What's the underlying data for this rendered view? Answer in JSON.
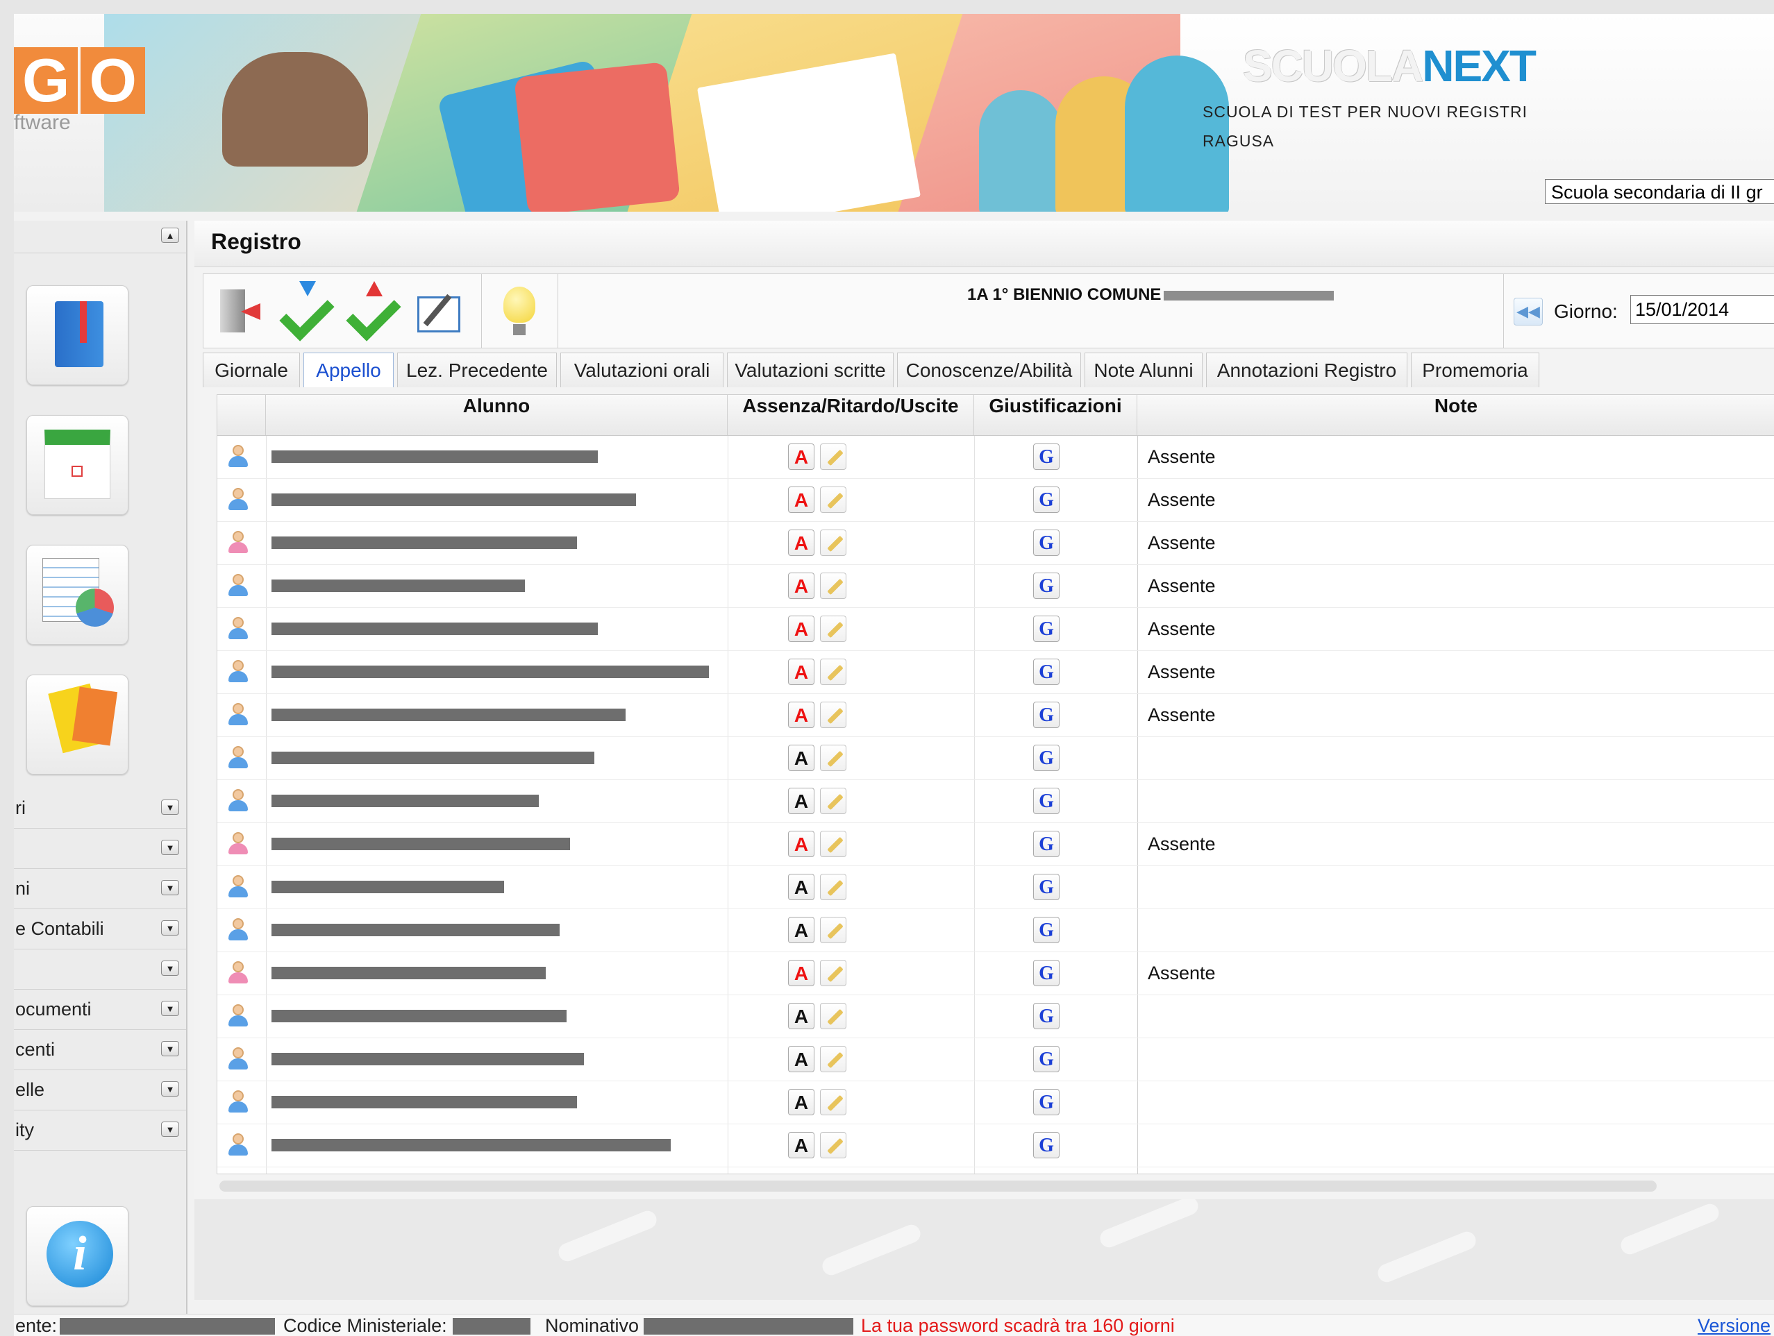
{
  "banner": {
    "logo_letters": [
      "G",
      "O"
    ],
    "logo_sub": "ftware",
    "brand_left": "SCUOLA",
    "brand_right": "NEXT",
    "school_name": "SCUOLA DI TEST PER NUOVI REGISTRI",
    "school_city": "RAGUSA",
    "school_select_value": "Scuola secondaria di II gr"
  },
  "sidebar": {
    "collapse_symbol": "▲",
    "expand_symbol": "▼",
    "launchers": [
      "book-icon",
      "calendar-icon",
      "chart-icon",
      "cards-icon"
    ],
    "info_symbol": "i",
    "menu": [
      {
        "label": "ri"
      },
      {
        "label": ""
      },
      {
        "label": "ni"
      },
      {
        "label": "e Contabili"
      },
      {
        "label": ""
      },
      {
        "label": "ocumenti"
      },
      {
        "label": "centi"
      },
      {
        "label": "elle"
      },
      {
        "label": "ity"
      }
    ]
  },
  "main": {
    "title": "Registro",
    "class_label": "1A 1° BIENNIO COMUNE",
    "toolbar_icons": [
      "exit-icon",
      "check-down-icon",
      "check-up-icon",
      "edit-icon",
      "bulb-icon"
    ],
    "date_nav_symbol": "◀◀",
    "date_label": "Giorno:",
    "date_value": "15/01/2014",
    "tabs": [
      "Giornale",
      "Appello",
      "Lez. Precedente",
      "Valutazioni orali",
      "Valutazioni scritte",
      "Conoscenze/Abilità",
      "Note Alunni",
      "Annotazioni Registro",
      "Promemoria"
    ],
    "active_tab": "Appello",
    "columns": [
      "Alunno",
      "Assenza/Ritardo/Uscite",
      "Giustificazioni",
      "Note"
    ],
    "absent_button_label": "A",
    "justify_button_label": "G",
    "rows": [
      {
        "student": "",
        "gender": "male",
        "absent": true,
        "note": "Assente"
      },
      {
        "student": "",
        "gender": "male",
        "absent": true,
        "note": "Assente"
      },
      {
        "student": "",
        "gender": "female",
        "absent": true,
        "note": "Assente"
      },
      {
        "student": "",
        "gender": "male",
        "absent": true,
        "note": "Assente"
      },
      {
        "student": "",
        "gender": "male",
        "absent": true,
        "note": "Assente"
      },
      {
        "student": "",
        "gender": "male",
        "absent": true,
        "note": "Assente"
      },
      {
        "student": "",
        "gender": "male",
        "absent": true,
        "note": "Assente"
      },
      {
        "student": "",
        "gender": "male",
        "absent": false,
        "note": ""
      },
      {
        "student": "",
        "gender": "male",
        "absent": false,
        "note": ""
      },
      {
        "student": "",
        "gender": "female",
        "absent": true,
        "note": "Assente"
      },
      {
        "student": "",
        "gender": "male",
        "absent": false,
        "note": ""
      },
      {
        "student": "",
        "gender": "male",
        "absent": false,
        "note": ""
      },
      {
        "student": "",
        "gender": "female",
        "absent": true,
        "note": "Assente"
      },
      {
        "student": "",
        "gender": "male",
        "absent": false,
        "note": ""
      },
      {
        "student": "",
        "gender": "male",
        "absent": false,
        "note": ""
      },
      {
        "student": "",
        "gender": "male",
        "absent": false,
        "note": ""
      },
      {
        "student": "",
        "gender": "male",
        "absent": false,
        "note": ""
      },
      {
        "student": "",
        "gender": "male",
        "absent": false,
        "note": ""
      }
    ]
  },
  "status": {
    "utente_label": "ente:",
    "codice_label": "Codice Ministeriale:",
    "nominativo_label": "Nominativo",
    "password_warning": "La tua password scadrà tra 160 giorni",
    "version_link": "Versione"
  },
  "colors": {
    "accent_blue": "#1a4fd0",
    "absent_red": "#e11111",
    "justify_blue": "#1b3fd6",
    "brand_next": "#1f8fd0",
    "logo_orange": "#f18b3c"
  }
}
